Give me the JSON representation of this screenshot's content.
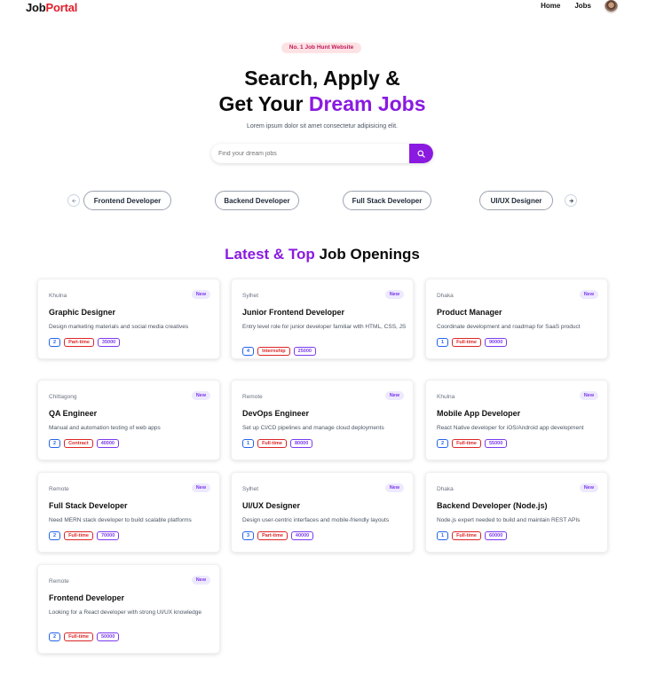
{
  "nav": {
    "logo_part1": "Job",
    "logo_part2": "Portal",
    "links": [
      "Home",
      "Jobs"
    ]
  },
  "hero": {
    "badge": "No. 1 Job Hunt Website",
    "title_line1": "Search, Apply &",
    "title_line2_prefix": "Get Your ",
    "title_line2_highlight": "Dream Jobs",
    "subtitle": "Lorem ipsum dolor sit amet consectetur adipisicing elit.",
    "search_placeholder": "Find your dream jobs"
  },
  "categories": [
    "Frontend Developer",
    "Backend Developer",
    "Full Stack Developer",
    "UI/UX Designer"
  ],
  "section": {
    "title_highlight": "Latest & Top",
    "title_rest": " Job Openings"
  },
  "jobs": [
    {
      "location": "Khulna",
      "badge": "New",
      "title": "Graphic Designer",
      "description": "Design marketing materials and social media creatives",
      "positions": "2",
      "type": "Part-time",
      "salary": "35000"
    },
    {
      "location": "Sylhet",
      "badge": "New",
      "title": "Junior Frontend Developer",
      "description": "Entry level role for junior developer familiar with HTML, CSS, JS",
      "positions": "4",
      "type": "Internship",
      "salary": "25000"
    },
    {
      "location": "Dhaka",
      "badge": "New",
      "title": "Product Manager",
      "description": "Coordinate development and roadmap for SaaS product",
      "positions": "1",
      "type": "Full-time",
      "salary": "90000"
    },
    {
      "location": "Chittagong",
      "badge": "New",
      "title": "QA Engineer",
      "description": "Manual and automation testing of web apps",
      "positions": "2",
      "type": "Contract",
      "salary": "40000"
    },
    {
      "location": "Remote",
      "badge": "New",
      "title": "DevOps Engineer",
      "description": "Set up CI/CD pipelines and manage cloud deployments",
      "positions": "1",
      "type": "Full-time",
      "salary": "80000"
    },
    {
      "location": "Khulna",
      "badge": "New",
      "title": "Mobile App Developer",
      "description": "React Native developer for iOS/Android app development",
      "positions": "2",
      "type": "Full-time",
      "salary": "55000"
    },
    {
      "location": "Remote",
      "badge": "New",
      "title": "Full Stack Developer",
      "description": "Need MERN stack developer to build scalable platforms",
      "positions": "2",
      "type": "Full-time",
      "salary": "70000"
    },
    {
      "location": "Sylhet",
      "badge": "New",
      "title": "UI/UX Designer",
      "description": "Design user-centric interfaces and mobile-friendly layouts",
      "positions": "3",
      "type": "Part-time",
      "salary": "40000"
    },
    {
      "location": "Dhaka",
      "badge": "New",
      "title": "Backend Developer (Node.js)",
      "description": "Node.js expert needed to build and maintain REST APIs",
      "positions": "1",
      "type": "Full-time",
      "salary": "60000"
    },
    {
      "location": "Remote",
      "badge": "New",
      "title": "Frontend Developer",
      "description": "Looking for a React developer with strong UI/UX knowledge",
      "positions": "2",
      "type": "Full-time",
      "salary": "50000"
    }
  ],
  "colors": {
    "brand_red": "#e11d2a",
    "accent_purple": "#8a1ae0",
    "tag_blue": "#2563eb",
    "tag_red": "#dc2626",
    "tag_violet": "#7c3aed"
  },
  "icons": {
    "search_button": "search-icon",
    "prev": "chevron-left-icon",
    "next": "chevron-right-icon"
  }
}
